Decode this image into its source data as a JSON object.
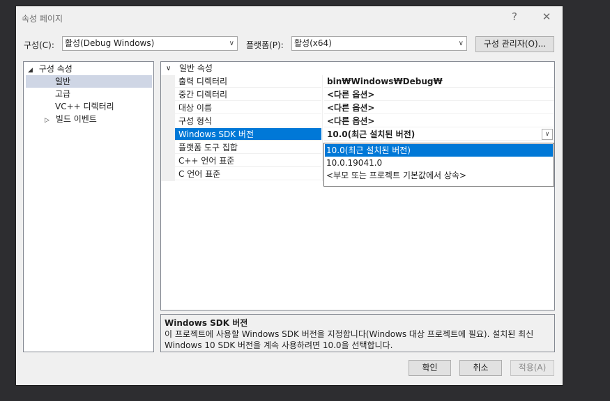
{
  "dialog": {
    "title": "속성 페이지",
    "help_label": "?",
    "close_label": "✕"
  },
  "toolbar": {
    "config_label": "구성(C):",
    "config_value": "활성(Debug Windows)",
    "platform_label": "플랫폼(P):",
    "platform_value": "활성(x64)",
    "config_manager_label": "구성 관리자(O)..."
  },
  "tree": {
    "root": "구성 속성",
    "items": [
      "일반",
      "고급",
      "VC++ 디렉터리",
      "빌드 이벤트"
    ]
  },
  "grid": {
    "category": "일반 속성",
    "rows": [
      {
        "name": "출력 디렉터리",
        "value": "bin₩Windows₩Debug₩"
      },
      {
        "name": "중간 디렉터리",
        "value": "<다른 옵션>"
      },
      {
        "name": "대상 이름",
        "value": "<다른 옵션>"
      },
      {
        "name": "구성 형식",
        "value": "<다른 옵션>"
      },
      {
        "name": "Windows SDK 버전",
        "value": "10.0(최근 설치된 버전)"
      },
      {
        "name": "플랫폼 도구 집합",
        "value": ""
      },
      {
        "name": "C++ 언어 표준",
        "value": ""
      },
      {
        "name": "C 언어 표준",
        "value": ""
      }
    ],
    "dropdown_options": [
      "10.0(최근 설치된 버전)",
      "10.0.19041.0",
      "<부모 또는 프로젝트 기본값에서 상속>"
    ]
  },
  "description": {
    "title": "Windows SDK 버전",
    "text": "이 프로젝트에 사용할 Windows SDK 버전을 지정합니다(Windows 대상 프로젝트에 필요). 설치된 최신 Windows 10 SDK 버전을 계속 사용하려면 10.0을 선택합니다."
  },
  "buttons": {
    "ok": "확인",
    "cancel": "취소",
    "apply": "적용(A)"
  }
}
